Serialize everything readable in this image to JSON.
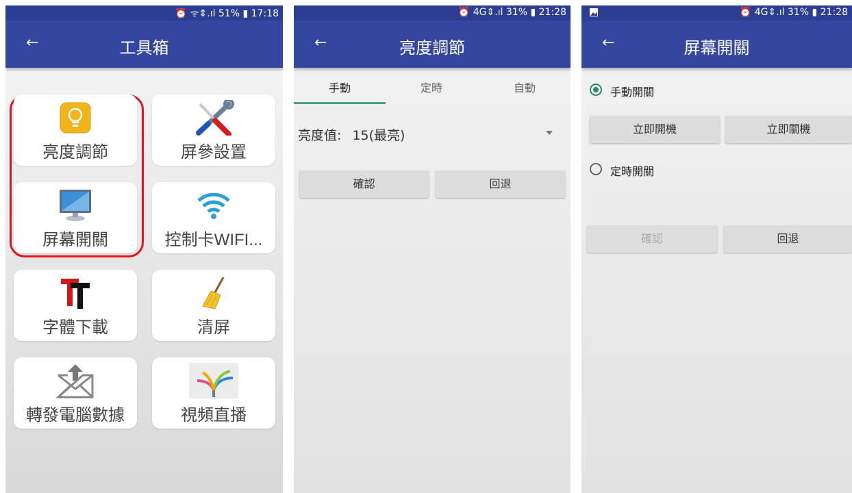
{
  "screen1": {
    "status": {
      "right": "⏰ ᯤ⇕.ıl 51% ▮ 17:18"
    },
    "title": "工具箱",
    "tiles": [
      {
        "label": "亮度調節",
        "icon": "bulb-icon"
      },
      {
        "label": "屏參設置",
        "icon": "tools-icon"
      },
      {
        "label": "屏幕開關",
        "icon": "monitor-icon"
      },
      {
        "label": "控制卡WIFI...",
        "icon": "wifi-icon"
      },
      {
        "label": "字體下載",
        "icon": "font-icon"
      },
      {
        "label": "清屏",
        "icon": "broom-icon"
      },
      {
        "label": "轉發電腦數據",
        "icon": "mail-upload-icon"
      },
      {
        "label": "視頻直播",
        "icon": "arrows-icon"
      }
    ]
  },
  "screen2": {
    "status": {
      "right": "⏰ 4G⇕.ıl 31% ▮ 21:28"
    },
    "title": "亮度調節",
    "tabs": [
      "手動",
      "定時",
      "自動"
    ],
    "brightness_label": "亮度值:",
    "brightness_value": "15(最亮)",
    "confirm": "確認",
    "back": "回退"
  },
  "screen3": {
    "status": {
      "right": "⏰ 4G⇕.ıl 31% ▮ 21:28"
    },
    "title": "屏幕開關",
    "manual_label": "手動開關",
    "power_on": "立即開機",
    "power_off": "立即關機",
    "timed_label": "定時開關",
    "confirm": "確認",
    "back": "回退"
  }
}
